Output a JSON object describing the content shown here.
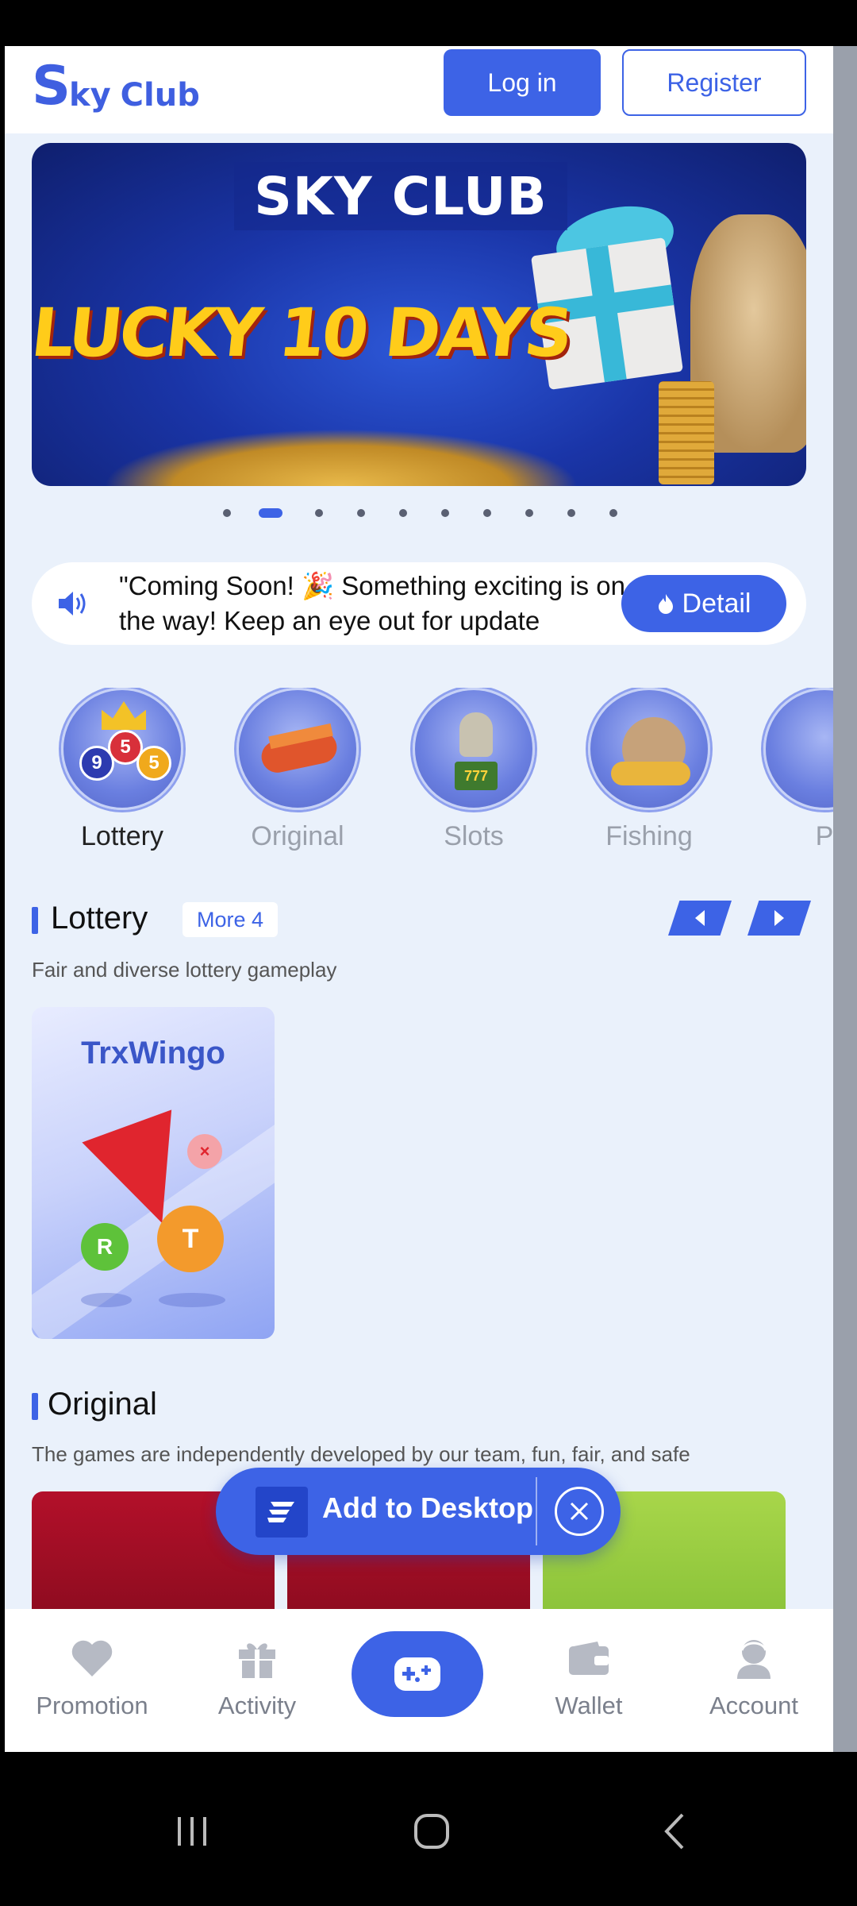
{
  "header": {
    "logo_big": "S",
    "logo_small": "ky",
    "logo_club": "Club",
    "login_label": "Log in",
    "register_label": "Register"
  },
  "banner": {
    "title": "SKY CLUB",
    "subtitle": "LUCKY 10 DAYS",
    "slide_count": 10,
    "active_slide": 2
  },
  "notice": {
    "text": "\"Coming Soon! 🎉 Something exciting is on the way! Keep an eye out for update",
    "detail_label": "Detail"
  },
  "categories": [
    {
      "label": "Lottery",
      "active": true
    },
    {
      "label": "Original",
      "active": false
    },
    {
      "label": "Slots",
      "active": false
    },
    {
      "label": "Fishing",
      "active": false
    },
    {
      "label": "P",
      "active": false
    }
  ],
  "lottery_section": {
    "title": "Lottery",
    "more_label": "More 4",
    "description": "Fair and diverse lottery gameplay",
    "game_title": "TrxWingo",
    "ball_r": "R",
    "ball_t": "T"
  },
  "original_section": {
    "title": "Original",
    "description": "The games are independently developed by our team, fun, fair, and safe"
  },
  "add_to_desktop": {
    "label": "Add to Desktop"
  },
  "tabbar": {
    "promotion": "Promotion",
    "activity": "Activity",
    "wallet": "Wallet",
    "account": "Account"
  },
  "colors": {
    "accent": "#3d63e6",
    "background": "#eaf1fb"
  }
}
